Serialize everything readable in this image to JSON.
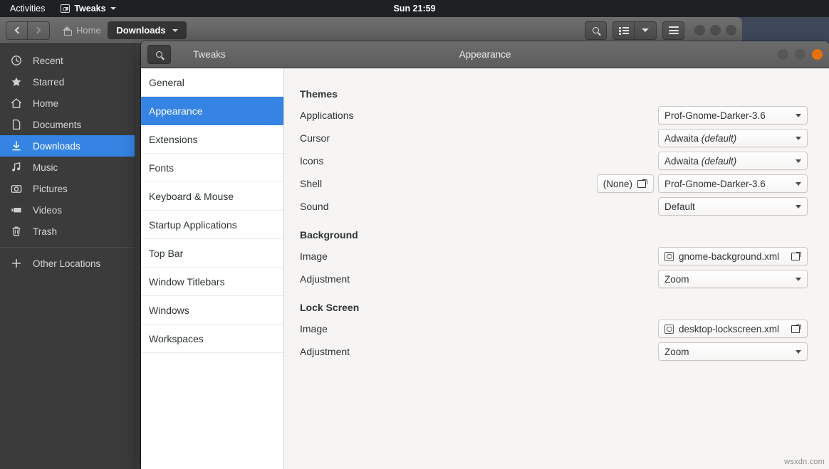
{
  "topbar": {
    "activities": "Activities",
    "app_name": "Tweaks",
    "app_icon": "tweaks-icon",
    "menu_caret": "chevron-down-icon",
    "clock": "Sun 21:59"
  },
  "file_manager": {
    "nav": {
      "back": "back-icon",
      "forward": "forward-icon"
    },
    "breadcrumb": {
      "home_label": "Home",
      "separator": "/",
      "current_label": "Downloads"
    },
    "header_buttons": {
      "search": "search-icon",
      "view_list": "list-view-icon",
      "view_dropdown": "chevron-down-icon",
      "menu": "hamburger-menu-icon"
    },
    "sidebar": {
      "items": [
        {
          "label": "Recent",
          "icon": "clock-icon",
          "selected": false
        },
        {
          "label": "Starred",
          "icon": "star-icon",
          "selected": false
        },
        {
          "label": "Home",
          "icon": "home-icon",
          "selected": false
        },
        {
          "label": "Documents",
          "icon": "document-icon",
          "selected": false
        },
        {
          "label": "Downloads",
          "icon": "download-icon",
          "selected": true
        },
        {
          "label": "Music",
          "icon": "music-icon",
          "selected": false
        },
        {
          "label": "Pictures",
          "icon": "camera-icon",
          "selected": false
        },
        {
          "label": "Videos",
          "icon": "video-icon",
          "selected": false
        },
        {
          "label": "Trash",
          "icon": "trash-icon",
          "selected": false
        }
      ],
      "other_locations": {
        "label": "Other Locations",
        "icon": "plus-icon"
      }
    }
  },
  "tweaks": {
    "search_icon": "search-icon",
    "sidebar_title": "Tweaks",
    "title": "Appearance",
    "window_controls": {
      "minimize": "minimize-button",
      "maximize": "maximize-button",
      "close": "close-button",
      "close_color": "#e8700c"
    },
    "sidebar": [
      {
        "label": "General",
        "selected": false
      },
      {
        "label": "Appearance",
        "selected": true
      },
      {
        "label": "Extensions",
        "selected": false
      },
      {
        "label": "Fonts",
        "selected": false
      },
      {
        "label": "Keyboard & Mouse",
        "selected": false
      },
      {
        "label": "Startup Applications",
        "selected": false
      },
      {
        "label": "Top Bar",
        "selected": false
      },
      {
        "label": "Window Titlebars",
        "selected": false
      },
      {
        "label": "Windows",
        "selected": false
      },
      {
        "label": "Workspaces",
        "selected": false
      }
    ],
    "sections": {
      "themes": {
        "title": "Themes",
        "applications": {
          "label": "Applications",
          "value": "Prof-Gnome-Darker-3.6"
        },
        "cursor": {
          "label": "Cursor",
          "value": "Adwaita ",
          "value_em": "(default)"
        },
        "icons": {
          "label": "Icons",
          "value": "Adwaita ",
          "value_em": "(default)"
        },
        "shell": {
          "label": "Shell",
          "file_value": "(None)",
          "value": "Prof-Gnome-Darker-3.6"
        },
        "sound": {
          "label": "Sound",
          "value": "Default"
        }
      },
      "background": {
        "title": "Background",
        "image": {
          "label": "Image",
          "value": "gnome-background.xml"
        },
        "adjustment": {
          "label": "Adjustment",
          "value": "Zoom"
        }
      },
      "lock_screen": {
        "title": "Lock Screen",
        "image": {
          "label": "Image",
          "value": "desktop-lockscreen.xml"
        },
        "adjustment": {
          "label": "Adjustment",
          "value": "Zoom"
        }
      }
    }
  },
  "watermark": "wsxdn.com",
  "colors": {
    "accent": "#3584e4",
    "close": "#e8700c",
    "desktop": "#3e4859"
  }
}
